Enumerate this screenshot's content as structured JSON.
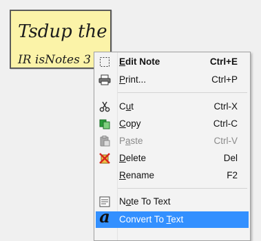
{
  "note": {
    "handwriting_line1": "Tsdup the",
    "handwriting_line2": "IR isNotes 3"
  },
  "menu": {
    "items": [
      {
        "pre": "",
        "u": "E",
        "post": "dit Note",
        "shortcut": "Ctrl+E",
        "icon": "dashed-square-icon"
      },
      {
        "pre": "",
        "u": "P",
        "post": "rint...",
        "shortcut": "Ctrl+P",
        "icon": "printer-icon"
      },
      {
        "pre": "C",
        "u": "u",
        "post": "t",
        "shortcut": "Ctrl-X",
        "icon": "scissors-icon"
      },
      {
        "pre": "",
        "u": "C",
        "post": "opy",
        "shortcut": "Ctrl-C",
        "icon": "copy-icon"
      },
      {
        "pre": "P",
        "u": "a",
        "post": "ste",
        "shortcut": "Ctrl-V",
        "icon": "clipboard-icon"
      },
      {
        "pre": "",
        "u": "D",
        "post": "elete",
        "shortcut": "Del",
        "icon": "delete-icon"
      },
      {
        "pre": "",
        "u": "R",
        "post": "ename",
        "shortcut": "F2",
        "icon": ""
      },
      {
        "pre": "N",
        "u": "o",
        "post": "te To Text",
        "shortcut": "",
        "icon": "note-to-text-icon"
      },
      {
        "pre": "Convert To ",
        "u": "T",
        "post": "ext",
        "shortcut": "",
        "icon": "handwriting-a-icon"
      }
    ]
  },
  "colors": {
    "highlight": "#3390ff",
    "note_background": "#fbf3a8",
    "delete_red": "#d7261e",
    "copy_green": "#2a9d3a"
  }
}
